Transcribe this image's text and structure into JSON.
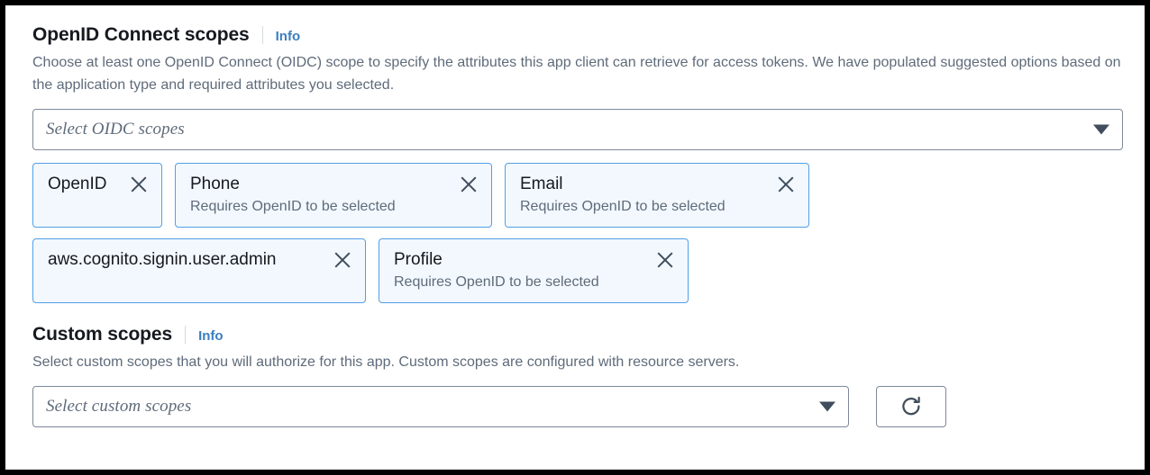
{
  "colors": {
    "accent_link": "#3b7ec1",
    "chip_border": "#539fe5",
    "chip_fill": "#f2f8fd",
    "text_primary": "#16191f",
    "text_secondary": "#5f6b7a",
    "control_border": "#7d8998",
    "frame": "#000000"
  },
  "oidc_section": {
    "title": "OpenID Connect scopes",
    "info_label": "Info",
    "description": "Choose at least one OpenID Connect (OIDC) scope to specify the attributes this app client can retrieve for access tokens. We have populated suggested options based on the application type and required attributes you selected.",
    "select": {
      "placeholder": "Select OIDC scopes",
      "value": "",
      "caret_icon": "chevron-down-icon"
    },
    "chips": [
      {
        "label": "OpenID",
        "sub": "",
        "remove_icon": "close-icon"
      },
      {
        "label": "Phone",
        "sub": "Requires OpenID to be selected",
        "remove_icon": "close-icon"
      },
      {
        "label": "Email",
        "sub": "Requires OpenID to be selected",
        "remove_icon": "close-icon"
      },
      {
        "label": "aws.cognito.signin.user.admin",
        "sub": "",
        "remove_icon": "close-icon"
      },
      {
        "label": "Profile",
        "sub": "Requires OpenID to be selected",
        "remove_icon": "close-icon"
      }
    ]
  },
  "custom_section": {
    "title": "Custom scopes",
    "info_label": "Info",
    "description": "Select custom scopes that you will authorize for this app. Custom scopes are configured with resource servers.",
    "select": {
      "placeholder": "Select custom scopes",
      "value": "",
      "caret_icon": "chevron-down-icon"
    },
    "refresh_button": {
      "icon": "refresh-icon",
      "label": ""
    }
  }
}
